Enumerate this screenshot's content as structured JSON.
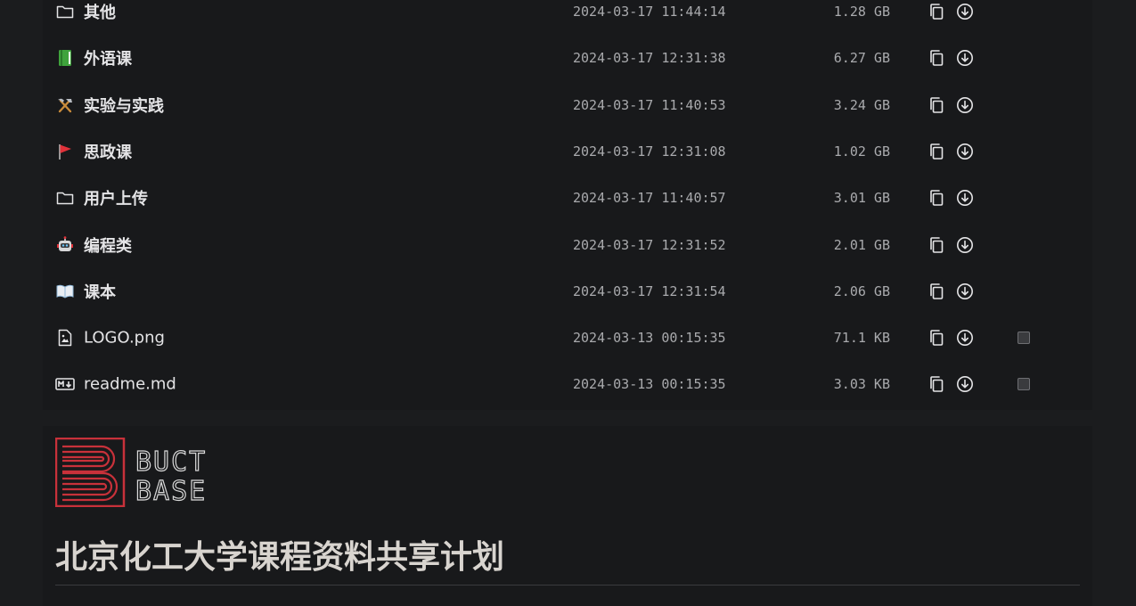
{
  "files": [
    {
      "name": "其他",
      "icon": "folder-icon",
      "date": "2024-03-17 11:44:14",
      "size": "1.28 GB",
      "selectable": false
    },
    {
      "name": "外语课",
      "icon": "green-book-icon",
      "date": "2024-03-17 12:31:38",
      "size": "6.27 GB",
      "selectable": false
    },
    {
      "name": "实验与实践",
      "icon": "hammer-pick-icon",
      "date": "2024-03-17 11:40:53",
      "size": "3.24 GB",
      "selectable": false
    },
    {
      "name": "思政课",
      "icon": "red-flag-icon",
      "date": "2024-03-17 12:31:08",
      "size": "1.02 GB",
      "selectable": false
    },
    {
      "name": "用户上传",
      "icon": "folder-icon",
      "date": "2024-03-17 11:40:57",
      "size": "3.01 GB",
      "selectable": false
    },
    {
      "name": "编程类",
      "icon": "robot-icon",
      "date": "2024-03-17 12:31:52",
      "size": "2.01 GB",
      "selectable": false
    },
    {
      "name": "课本",
      "icon": "open-book-icon",
      "date": "2024-03-17 12:31:54",
      "size": "2.06 GB",
      "selectable": false
    },
    {
      "name": "LOGO.png",
      "icon": "image-file-icon",
      "date": "2024-03-13 00:15:35",
      "size": "71.1 KB",
      "selectable": true
    },
    {
      "name": "readme.md",
      "icon": "markdown-icon",
      "date": "2024-03-13 00:15:35",
      "size": "3.03 KB",
      "selectable": true
    }
  ],
  "readme": {
    "logo_text_line1": "BUCT",
    "logo_text_line2": "BASE",
    "heading": "北京化工大学课程资料共享计划"
  },
  "colors": {
    "background": "#1b1c1e",
    "panel": "#18191b",
    "text": "#e4e4e6",
    "muted": "#a9aaad",
    "logo_red": "#c8313a",
    "heading": "#d8d4cf"
  }
}
